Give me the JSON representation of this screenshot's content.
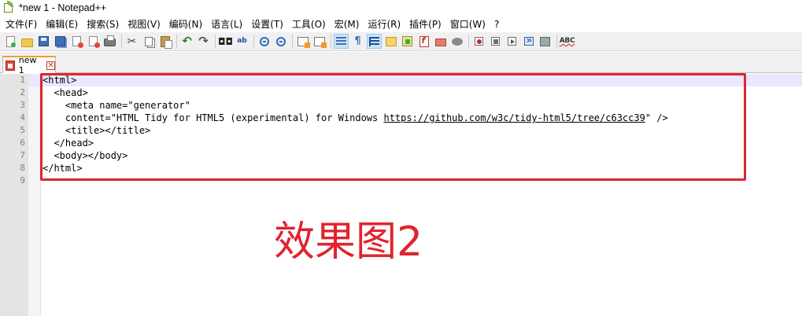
{
  "window": {
    "title": "*new 1 - Notepad++"
  },
  "menu": [
    "文件(F)",
    "编辑(E)",
    "搜索(S)",
    "视图(V)",
    "编码(N)",
    "语言(L)",
    "设置(T)",
    "工具(O)",
    "宏(M)",
    "运行(R)",
    "插件(P)",
    "窗口(W)",
    "?"
  ],
  "toolbar": {
    "icons": [
      "new-file-icon",
      "open-folder-icon",
      "save-icon",
      "save-all-icon",
      "close-icon",
      "close-all-icon",
      "print-icon",
      "cut-icon",
      "copy-icon",
      "paste-icon",
      "undo-icon",
      "redo-icon",
      "find-icon",
      "replace-icon",
      "zoom-in-icon",
      "zoom-out-icon",
      "sync-vertical-icon",
      "sync-horizontal-icon",
      "word-wrap-icon",
      "show-all-chars-icon",
      "indent-guide-icon",
      "folder-workspace-icon",
      "document-map-icon",
      "function-list-icon",
      "folder-as-workspace-icon",
      "monitoring-icon",
      "record-macro-icon",
      "stop-macro-icon",
      "play-macro-icon",
      "run-macro-multiple-icon",
      "save-macro-icon",
      "spell-check-icon"
    ],
    "spell_label": "ABC"
  },
  "tabs": [
    {
      "label": "new 1",
      "close": "✕"
    }
  ],
  "editor": {
    "lines": [
      {
        "n": "1",
        "text": "<html>"
      },
      {
        "n": "2",
        "text": "  <head>"
      },
      {
        "n": "3",
        "text": "    <meta name=\"generator\""
      },
      {
        "n": "4",
        "pre": "    content=\"HTML Tidy for HTML5 (experimental) for Windows ",
        "url": "https://github.com/w3c/tidy-html5/tree/c63cc39",
        "post": "\" />"
      },
      {
        "n": "5",
        "text": "    <title></title>"
      },
      {
        "n": "6",
        "text": "  </head>"
      },
      {
        "n": "7",
        "text": "  <body></body>"
      },
      {
        "n": "8",
        "text": "</html>"
      },
      {
        "n": "9",
        "text": ""
      }
    ]
  },
  "annotation": {
    "caption": "效果图2",
    "color": "#e0242e"
  },
  "colors": {
    "current_line": "#e8e8ff",
    "tab_accent": "#f39c32"
  }
}
